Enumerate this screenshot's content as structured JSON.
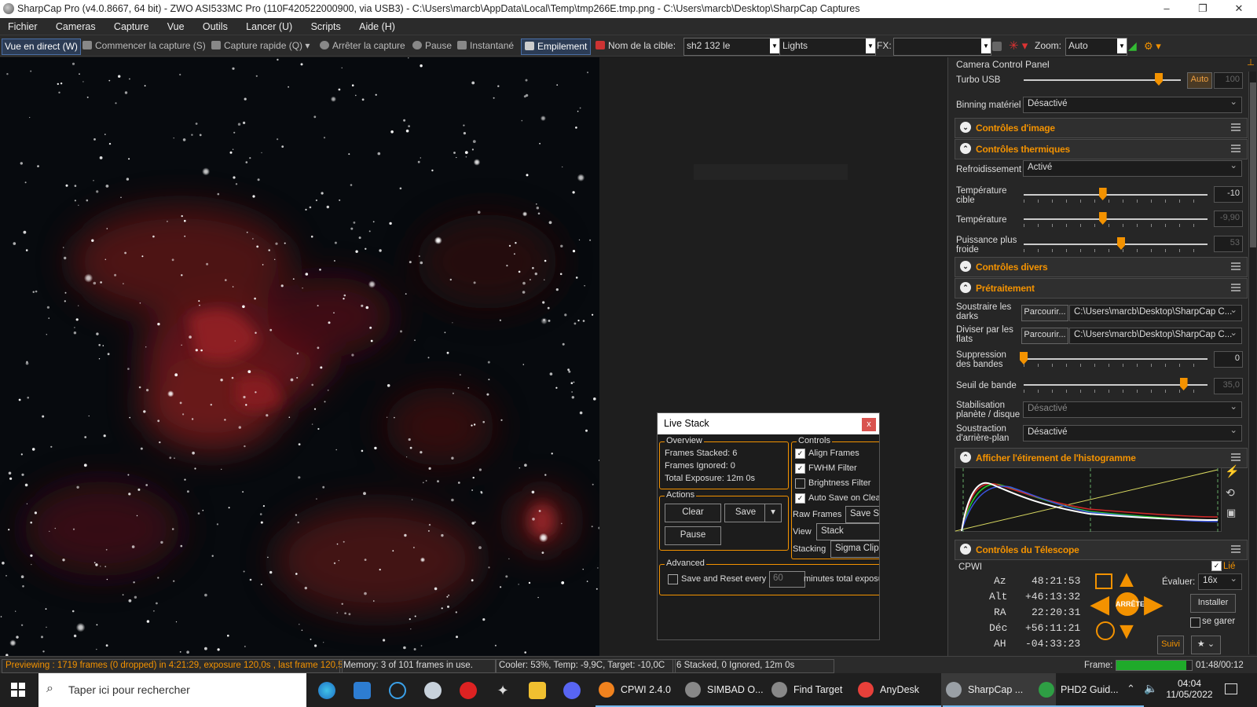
{
  "window": {
    "title": "SharpCap Pro (v4.0.8667, 64 bit) - ZWO ASI533MC Pro (110F420522000900, via USB3) - C:\\Users\\marcb\\AppData\\Local\\Temp\\tmp266E.tmp.png - C:\\Users\\marcb\\Desktop\\SharpCap Captures",
    "minimize": "–",
    "maximize": "❐",
    "close": "✕"
  },
  "menu": [
    "Fichier",
    "Cameras",
    "Capture",
    "Vue",
    "Outils",
    "Lancer (U)",
    "Scripts",
    "Aide (H)"
  ],
  "toolbar": {
    "live_view": "Vue en direct (W)",
    "start_capture": "Commencer la capture (S)",
    "quick_capture": "Capture rapide (Q)",
    "stop_capture": "Arrêter la capture",
    "pause": "Pause",
    "snapshot": "Instantané",
    "stacking": "Empilement",
    "target_label": "Nom de la cible:",
    "target_value": "sh2 132 le",
    "frame_type": "Lights",
    "fx_label": "FX:",
    "fx_value": "",
    "zoom_label": "Zoom:",
    "zoom_value": "Auto"
  },
  "panel": {
    "title": "Camera Control Panel",
    "turbo_label": "Turbo USB",
    "turbo_auto": "Auto",
    "turbo_value": "100",
    "turbo_level": 0.86,
    "binning_label": "Binning matériel",
    "binning_value": "Désactivé",
    "sec_image": "Contrôles d'image",
    "sec_thermal": "Contrôles thermiques",
    "cooling_label": "Refroidissement",
    "cooling_value": "Activé",
    "target_temp_label": "Température cible",
    "target_temp_value": "-10",
    "target_temp_level": 0.43,
    "temp_label": "Température",
    "temp_value": "-9,90",
    "temp_level": 0.43,
    "cooler_power_label": "Puissance plus froide",
    "cooler_power_value": "53",
    "cooler_power_level": 0.53,
    "sec_misc": "Contrôles divers",
    "sec_preproc": "Prétraitement",
    "darks_label": "Soustraire les darks",
    "flats_label": "Diviser par les flats",
    "browse": "Parcourir...",
    "darks_path": "C:\\Users\\marcb\\Desktop\\SharpCap C...",
    "flats_path": "C:\\Users\\marcb\\Desktop\\SharpCap C...",
    "banding_label": "Suppression des bandes",
    "banding_value": "0",
    "banding_level": 0.0,
    "band_threshold_label": "Seuil de bande",
    "band_threshold_value": "35,0",
    "band_threshold_level": 0.87,
    "stabilization_label": "Stabilisation planète / disque",
    "stabilization_value": "Désactivé",
    "bg_sub_label": "Soustraction d'arrière-plan",
    "bg_sub_value": "Désactivé",
    "sec_histogram": "Afficher l'étirement de l'histogramme",
    "sec_telescope": "Contrôles du Télescope",
    "scope_name": "CPWI",
    "linked_label": "Lié",
    "coords": [
      {
        "label": "Az",
        "value": "48:21:53"
      },
      {
        "label": "Alt",
        "value": "+46:13:32"
      },
      {
        "label": "RA",
        "value": "22:20:31"
      },
      {
        "label": "Déc",
        "value": "+56:11:21"
      },
      {
        "label": "AH",
        "value": "-04:33:23"
      }
    ],
    "stop_label": "ARRÊTE",
    "rate_label": "Évaluer:",
    "rate_value": "16x",
    "install_label": "Installer",
    "park_label": "se garer",
    "track_label": "Suivi"
  },
  "livestack": {
    "title": "Live Stack",
    "close": "x",
    "overview_title": "Overview",
    "frames_stacked": "Frames Stacked: 6",
    "frames_ignored": "Frames Ignored:  0",
    "total_exposure": "Total Exposure:   12m 0s",
    "actions_title": "Actions",
    "clear": "Clear",
    "save": "Save",
    "pause": "Pause",
    "controls_title": "Controls",
    "align": "Align Frames",
    "fwhm": "FWHM Filter",
    "brightness": "Brightness Filter",
    "autosave": "Auto Save on Clea",
    "raw_label": "Raw Frames",
    "raw_value": "Save St",
    "view_label": "View",
    "view_value": "Stack",
    "stacking_label": "Stacking",
    "stacking_value": "Sigma Clipp",
    "advanced_title": "Advanced",
    "save_reset": "Save and Reset every",
    "minutes_value": "60",
    "minutes_suffix": "minutes total exposu"
  },
  "status": {
    "preview": "Previewing : 1719 frames (0 dropped) in 4:21:29, exposure 120,0s , last frame 120,5",
    "memory": "Memory: 3 of 101 frames in use.",
    "cooler": "Cooler: 53%, Temp: -9,9C, Target: -10,0C",
    "stack": "6 Stacked, 0 Ignored, 12m 0s",
    "frame_label": "Frame:",
    "frame_progress": 0.93,
    "frame_time": "01:48/00:12"
  },
  "taskbar": {
    "search_placeholder": "Taper ici pour rechercher",
    "apps": [
      {
        "label": "CPWI 2.4.0",
        "color": "#f0821e"
      },
      {
        "label": "SIMBAD O...",
        "color": "#888888"
      },
      {
        "label": "Find Target",
        "color": "#888888"
      },
      {
        "label": "AnyDesk",
        "color": "#e8403a"
      },
      {
        "label": "SharpCap ...",
        "color": "#9aa0a6"
      },
      {
        "label": "PHD2 Guid...",
        "color": "#2e9e44"
      }
    ],
    "time": "04:04",
    "date": "11/05/2022"
  },
  "colors": {
    "accent": "#f39200",
    "nebula": "#8a1f22"
  }
}
